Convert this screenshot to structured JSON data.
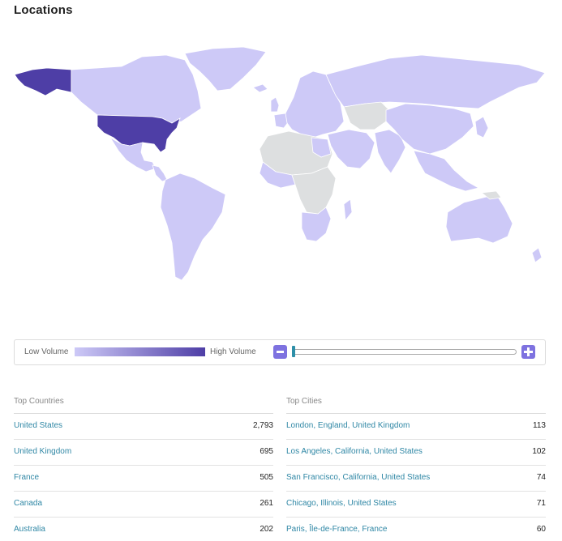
{
  "page": {
    "title": "Locations"
  },
  "colors": {
    "high": "#4e3ea6",
    "low": "#cdc9f7",
    "no_data": "#dddfe0",
    "link": "#2f87a5",
    "zoom_button": "#7e72e0"
  },
  "legend": {
    "low_label": "Low Volume",
    "high_label": "High Volume",
    "zoom_out_icon": "minus-icon",
    "zoom_in_icon": "plus-icon",
    "zoom_level": 0
  },
  "top_countries": {
    "heading": "Top Countries",
    "rows": [
      {
        "name": "United States",
        "value": "2,793"
      },
      {
        "name": "United Kingdom",
        "value": "695"
      },
      {
        "name": "France",
        "value": "505"
      },
      {
        "name": "Canada",
        "value": "261"
      },
      {
        "name": "Australia",
        "value": "202"
      }
    ]
  },
  "top_cities": {
    "heading": "Top Cities",
    "rows": [
      {
        "name": "London, England, United Kingdom",
        "value": "113"
      },
      {
        "name": "Los Angeles, California, United States",
        "value": "102"
      },
      {
        "name": "San Francisco, California, United States",
        "value": "74"
      },
      {
        "name": "Chicago, Illinois, United States",
        "value": "71"
      },
      {
        "name": "Paris, Île-de-France, France",
        "value": "60"
      }
    ]
  }
}
